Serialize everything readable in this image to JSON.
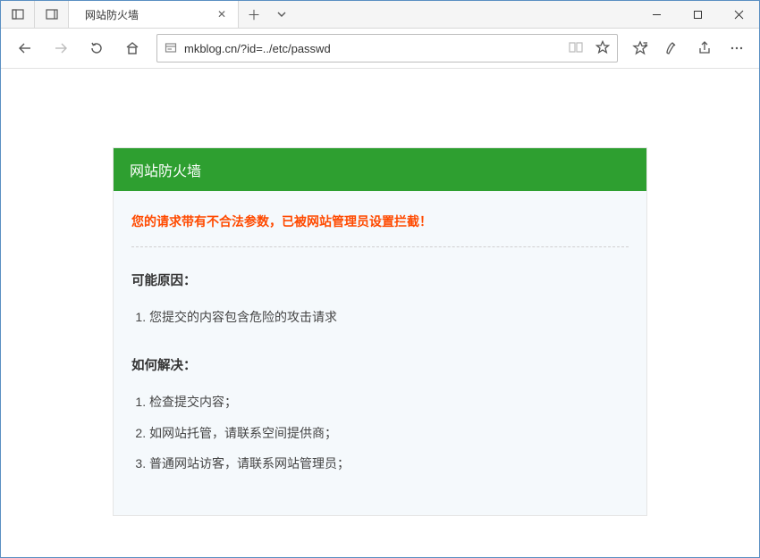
{
  "tab": {
    "title": "网站防火墙"
  },
  "toolbar": {
    "url": "mkblog.cn/?id=../etc/passwd"
  },
  "page": {
    "header": "网站防火墙",
    "alert": "您的请求带有不合法参数，已被网站管理员设置拦截！",
    "reason_title": "可能原因：",
    "reason_items": [
      "您提交的内容包含危险的攻击请求"
    ],
    "solve_title": "如何解决：",
    "solve_items": [
      "检查提交内容；",
      "如网站托管，请联系空间提供商；",
      "普通网站访客，请联系网站管理员；"
    ]
  }
}
